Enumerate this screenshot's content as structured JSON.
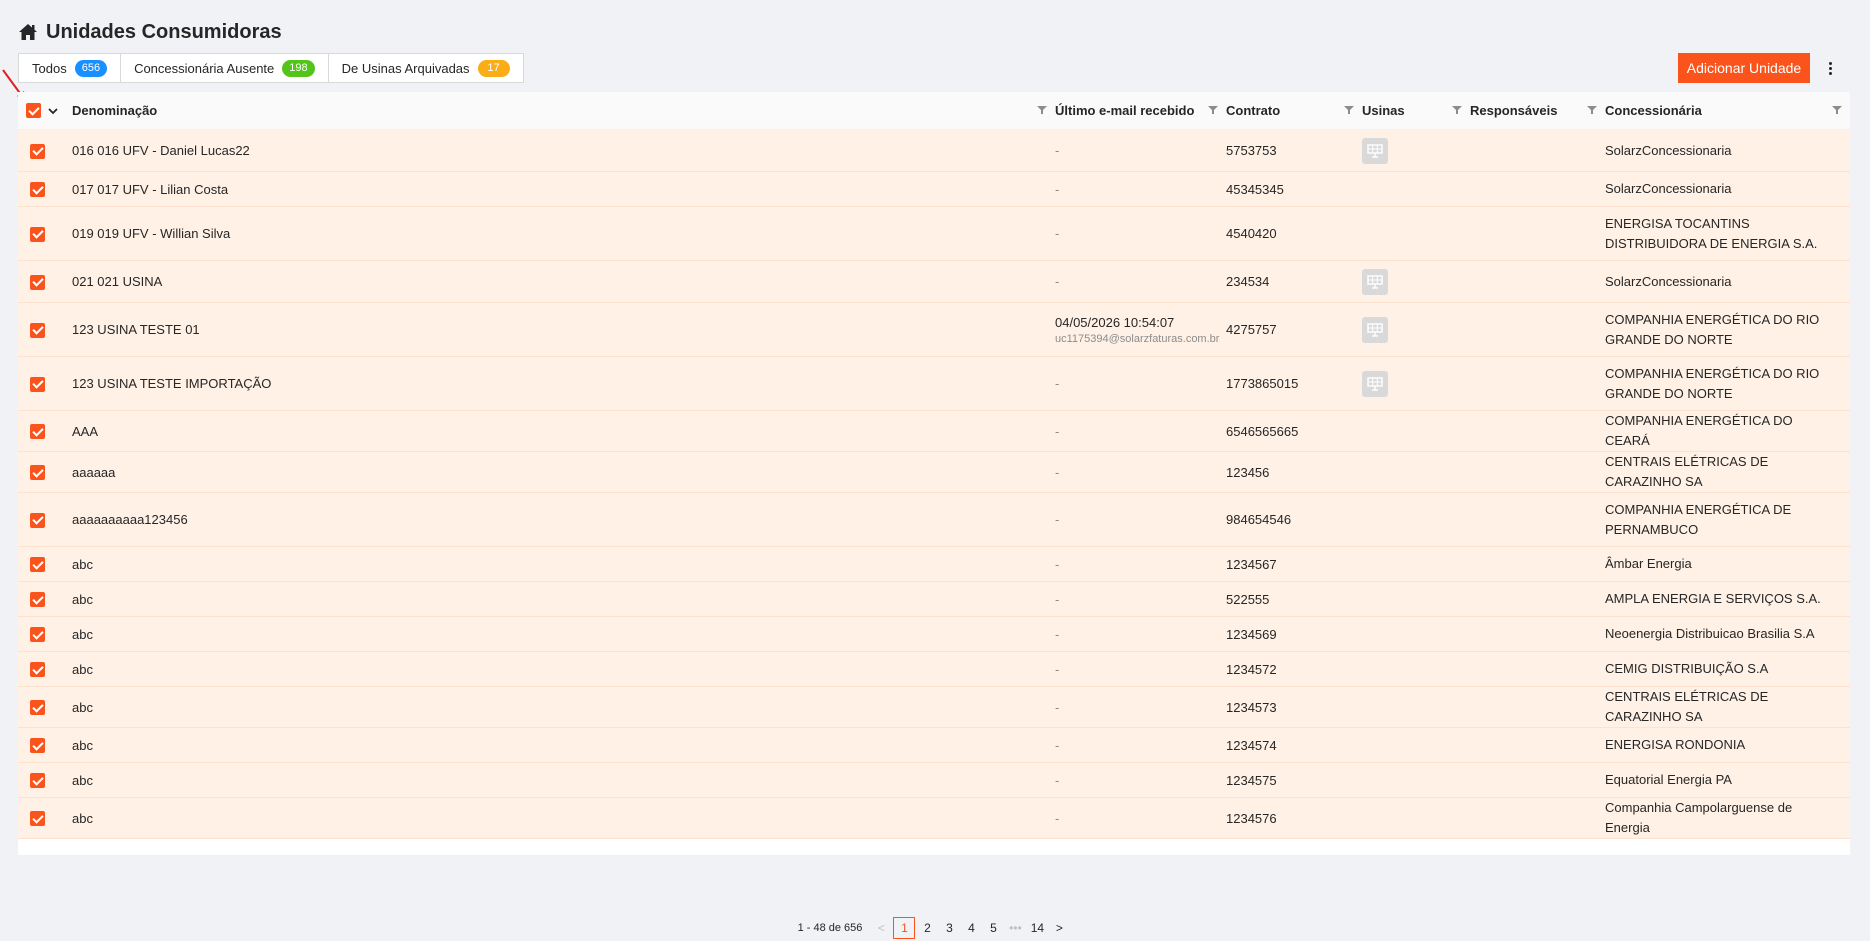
{
  "page": {
    "title": "Unidades Consumidoras"
  },
  "tabs": [
    {
      "label": "Todos",
      "count": "656",
      "color": "#1890ff"
    },
    {
      "label": "Concessionária Ausente",
      "count": "198",
      "color": "#52c41a"
    },
    {
      "label": "De Usinas Arquivadas",
      "count": "17",
      "color": "#faad14"
    }
  ],
  "toolbar": {
    "add_label": "Adicionar Unidade"
  },
  "columns": {
    "denominacao": "Denominação",
    "email": "Último e-mail recebido",
    "contrato": "Contrato",
    "usinas": "Usinas",
    "responsaveis": "Responsáveis",
    "concessionaria": "Concessionária"
  },
  "rows": [
    {
      "name": "016 016 UFV - Daniel Lucas22",
      "email": "-",
      "contrato": "5753753",
      "usina": true,
      "conc": "SolarzConcessionaria"
    },
    {
      "name": "017 017 UFV - Lilian Costa",
      "email": "-",
      "contrato": "45345345",
      "usina": false,
      "conc": "SolarzConcessionaria"
    },
    {
      "name": "019 019 UFV - Willian Silva",
      "email": "-",
      "contrato": "4540420",
      "usina": false,
      "conc": "ENERGISA TOCANTINS DISTRIBUIDORA DE ENERGIA S.A."
    },
    {
      "name": "021 021 USINA",
      "email": "-",
      "contrato": "234534",
      "usina": true,
      "conc": "SolarzConcessionaria"
    },
    {
      "name": "123 USINA TESTE 01",
      "email_date": "04/05/2026 10:54:07",
      "email_addr": "uc1175394@solarzfaturas.com.br",
      "contrato": "4275757",
      "usina": true,
      "conc": "COMPANHIA ENERGÉTICA DO RIO GRANDE DO NORTE"
    },
    {
      "name": "123 USINA TESTE IMPORTAÇÃO",
      "email": "-",
      "contrato": "1773865015",
      "usina": true,
      "conc": "COMPANHIA ENERGÉTICA DO RIO GRANDE DO NORTE"
    },
    {
      "name": "AAA",
      "email": "-",
      "contrato": "6546565665",
      "usina": false,
      "conc": "COMPANHIA ENERGÉTICA DO CEARÁ"
    },
    {
      "name": "aaaaaa",
      "email": "-",
      "contrato": "123456",
      "usina": false,
      "conc": "CENTRAIS ELÉTRICAS DE CARAZINHO SA"
    },
    {
      "name": "aaaaaaaaaa123456",
      "email": "-",
      "contrato": "984654546",
      "usina": false,
      "conc": "COMPANHIA ENERGÉTICA DE PERNAMBUCO"
    },
    {
      "name": "abc",
      "email": "-",
      "contrato": "1234567",
      "usina": false,
      "conc": "Âmbar Energia"
    },
    {
      "name": "abc",
      "email": "-",
      "contrato": "522555",
      "usina": false,
      "conc": "AMPLA ENERGIA E SERVIÇOS S.A."
    },
    {
      "name": "abc",
      "email": "-",
      "contrato": "1234569",
      "usina": false,
      "conc": "Neoenergia Distribuicao Brasilia S.A"
    },
    {
      "name": "abc",
      "email": "-",
      "contrato": "1234572",
      "usina": false,
      "conc": "CEMIG DISTRIBUIÇÃO S.A"
    },
    {
      "name": "abc",
      "email": "-",
      "contrato": "1234573",
      "usina": false,
      "conc": "CENTRAIS ELÉTRICAS DE CARAZINHO SA"
    },
    {
      "name": "abc",
      "email": "-",
      "contrato": "1234574",
      "usina": false,
      "conc": "ENERGISA RONDONIA"
    },
    {
      "name": "abc",
      "email": "-",
      "contrato": "1234575",
      "usina": false,
      "conc": "Equatorial Energia PA"
    },
    {
      "name": "abc",
      "email": "-",
      "contrato": "1234576",
      "usina": false,
      "conc": "Companhia Campolarguense de Energia"
    }
  ],
  "pagination": {
    "total": "1 - 48 de 656",
    "pages": [
      "1",
      "2",
      "3",
      "4",
      "5"
    ],
    "ellipsis": "•••",
    "last": "14",
    "current": "1"
  },
  "colors": {
    "accent": "#fa541c",
    "row_selected": "#fff1e6"
  }
}
